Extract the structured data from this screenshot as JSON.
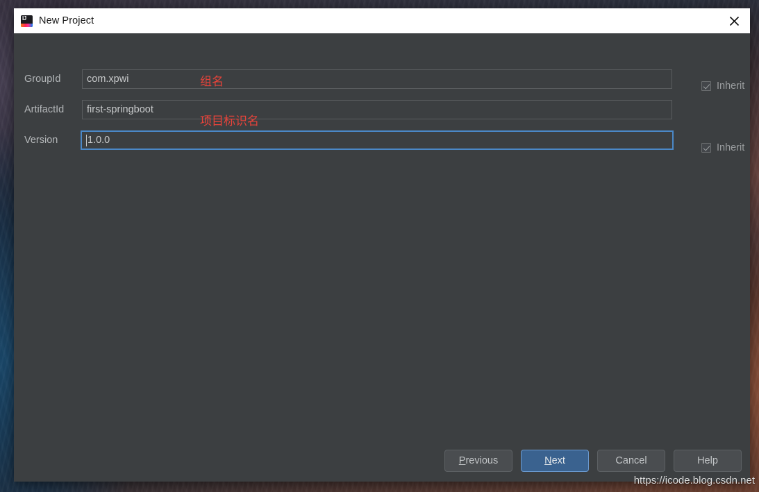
{
  "window": {
    "title": "New Project",
    "icon": "intellij-idea-icon",
    "close_icon": "close-icon"
  },
  "form": {
    "rows": [
      {
        "label": "GroupId",
        "value": "com.xpwi",
        "focused": false,
        "annotation": "组名",
        "inherit": {
          "label": "Inherit",
          "checked": true
        }
      },
      {
        "label": "ArtifactId",
        "value": "first-springboot",
        "focused": false,
        "annotation": "项目标识名",
        "inherit": null
      },
      {
        "label": "Version",
        "value": "1.0.0",
        "focused": true,
        "annotation": "",
        "inherit": {
          "label": "Inherit",
          "checked": true
        }
      }
    ]
  },
  "footer": {
    "buttons": [
      {
        "label": "Previous",
        "mnemonic": "P",
        "primary": false
      },
      {
        "label": "Next",
        "mnemonic": "N",
        "primary": true
      },
      {
        "label": "Cancel",
        "mnemonic": "",
        "primary": false
      },
      {
        "label": "Help",
        "mnemonic": "",
        "primary": false
      }
    ]
  },
  "watermark": "https://icode.blog.csdn.net",
  "colors": {
    "dialog_background": "#3c3f41",
    "titlebar_background": "#ffffff",
    "accent_focus": "#4b88c7",
    "primary_button": "#3a628f",
    "annotation_red": "#e8433a",
    "label_text": "#b4b7b9"
  }
}
